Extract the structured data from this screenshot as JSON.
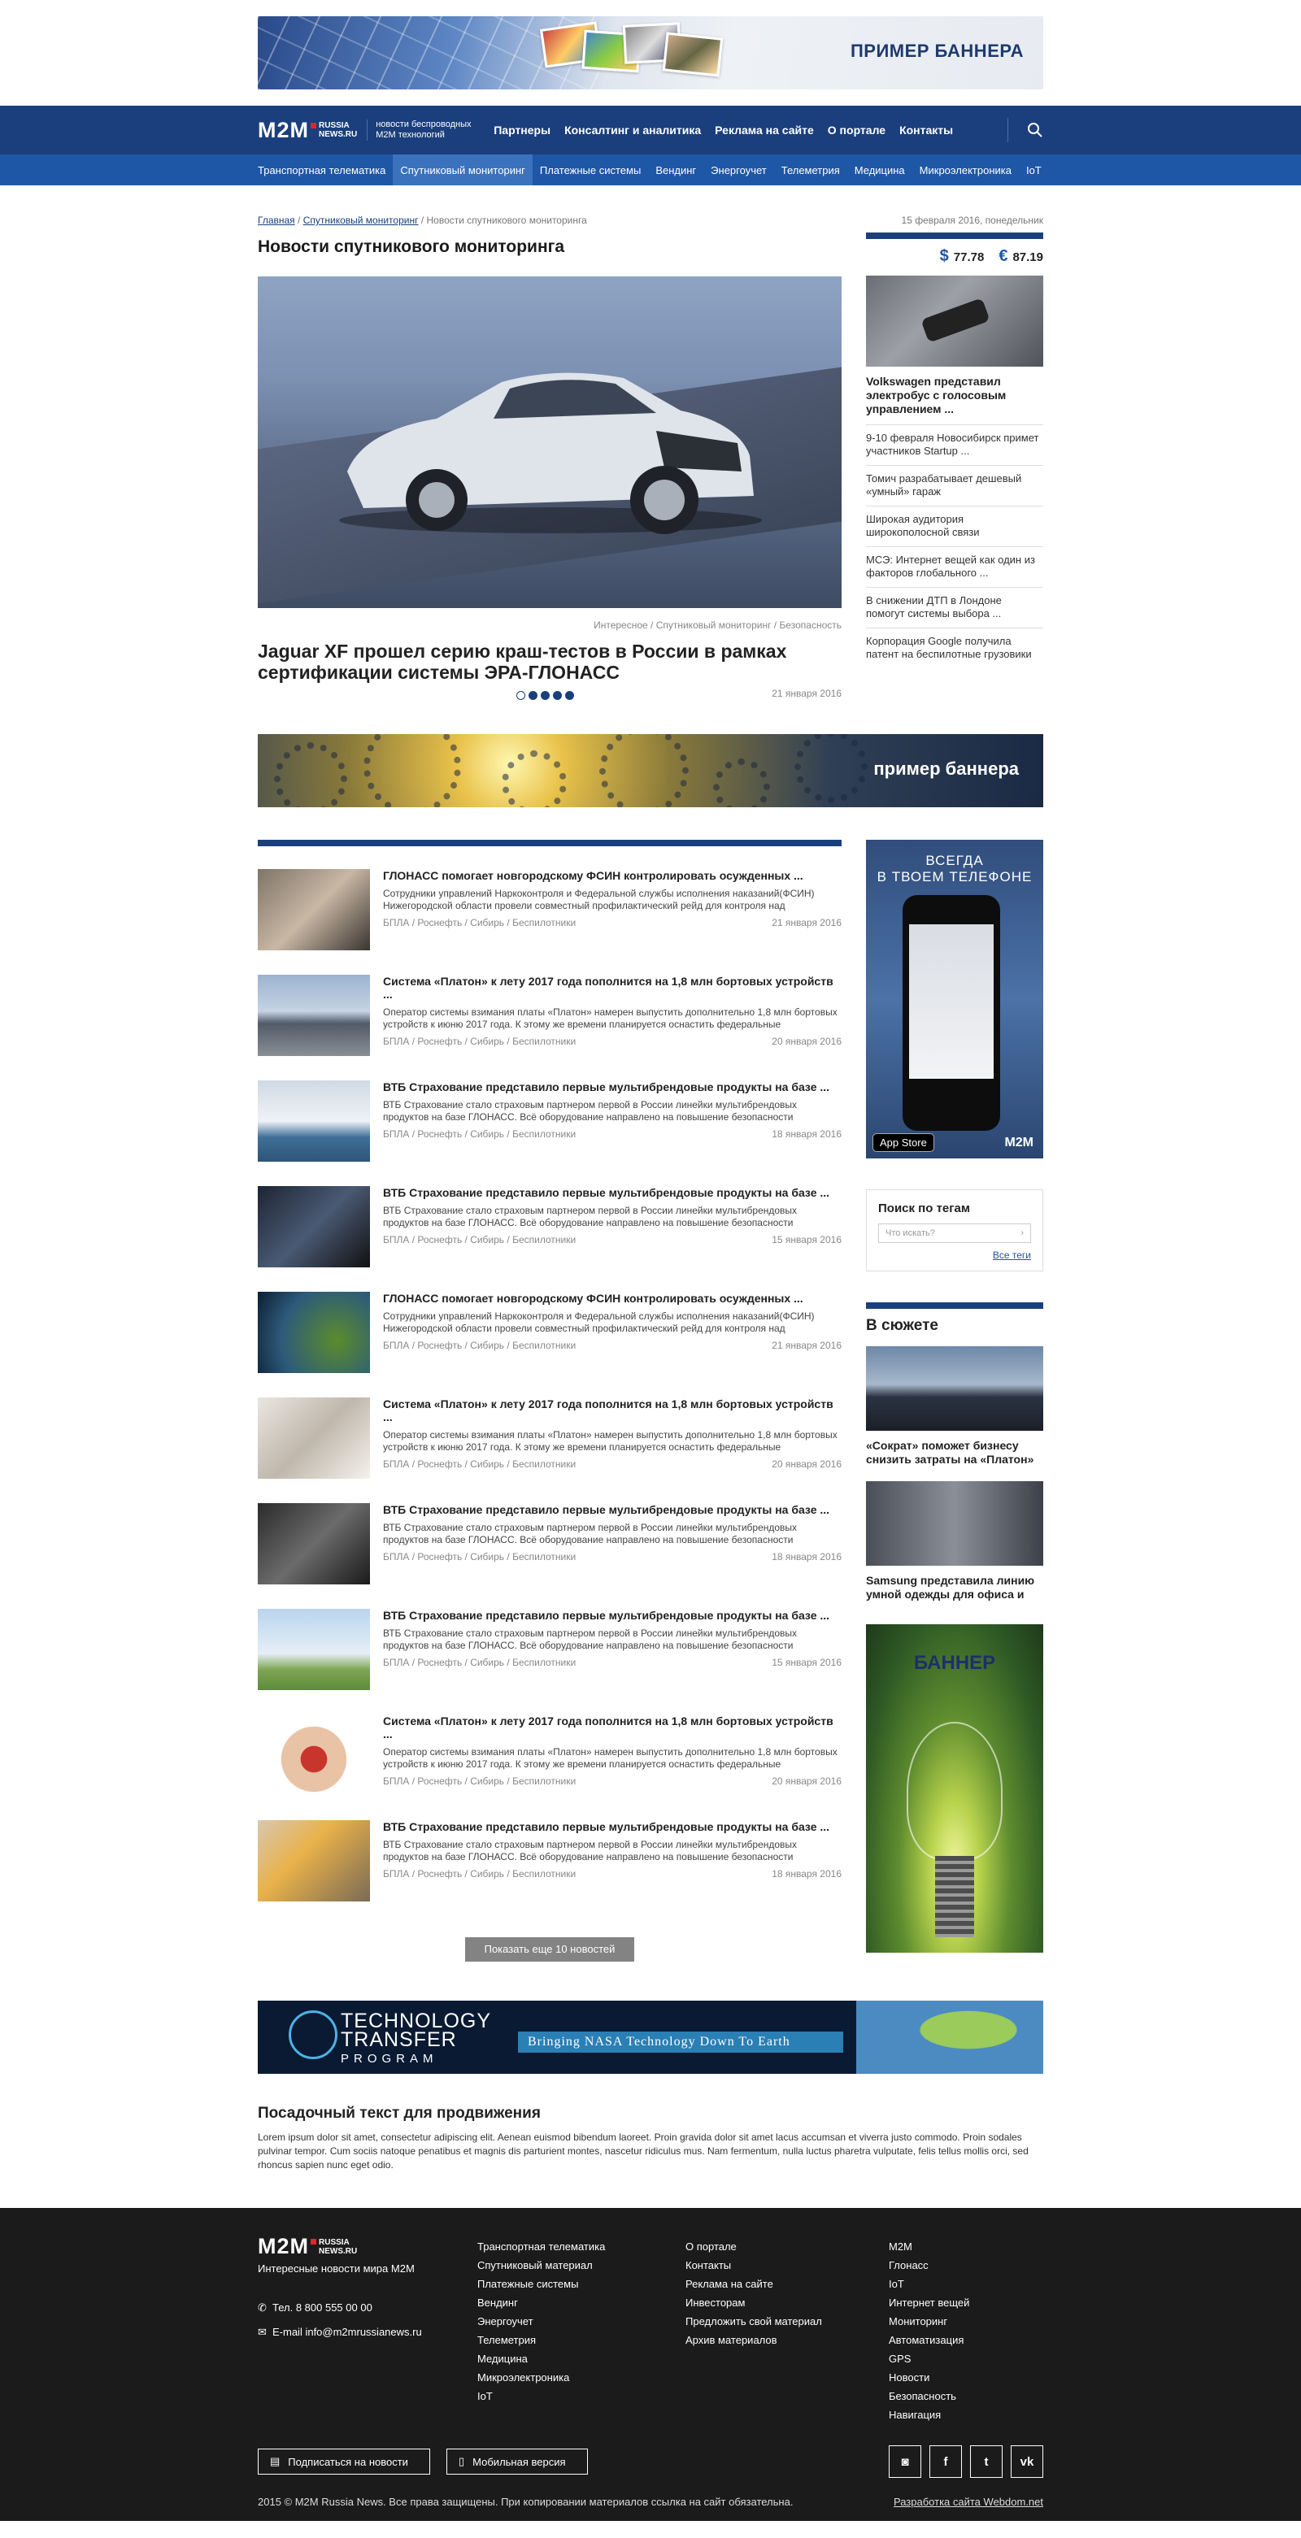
{
  "top_banner": {
    "label": "ПРИМЕР БАННЕРА"
  },
  "header": {
    "logo": "M2M",
    "logo_site_1": "RUSSIA",
    "logo_site_2": "NEWS.RU",
    "tagline": "новости беспроводных M2M технологий",
    "nav": [
      "Партнеры",
      "Консалтинг и аналитика",
      "Реклама на сайте",
      "О портале",
      "Контакты"
    ]
  },
  "subnav": [
    "Транспортная телематика",
    "Спутниковый мониторинг",
    "Платежные системы",
    "Вендинг",
    "Энергоучет",
    "Телеметрия",
    "Медицина",
    "Микроэлектроника",
    "IoT"
  ],
  "breadcrumb": {
    "home": "Главная",
    "section": "Спутниковый мониторинг",
    "current": "Новости спутникового мониторинга"
  },
  "page_title": "Новости спутникового мониторинга",
  "date_top": "15 февраля 2016, понедельник",
  "rates": {
    "usd_sym": "$",
    "usd": "77.78",
    "eur_sym": "€",
    "eur": "87.19"
  },
  "hero": {
    "meta": "Интересное / Спутниковый мониторинг / Безопасность",
    "title": "Jaguar XF прошел серию краш-тестов в России в рамках сертификации системы ЭРА-ГЛОНАСС",
    "date": "21 января 2016"
  },
  "side_news": {
    "lead": "Volkswagen представил электробус с голосовым управлением ...",
    "items": [
      "9-10 февраля Новосибирск примет участников Startup ...",
      "Томич разрабатывает дешевый «умный» гараж",
      "Широкая аудитория широкополосной связи",
      "МСЭ: Интернет вещей как один из факторов глобального ...",
      "В снижении ДТП в Лондоне помогут системы выбора ...",
      "Корпорация Google получила патент на беспилотные грузовики"
    ]
  },
  "mid_banner": {
    "label": "пример баннера"
  },
  "news": [
    {
      "title": "ГЛОНАСС помогает новгородскому ФСИН контролировать осужденных ...",
      "text": "Сотрудники управлений Наркоконтроля и Федеральной службы исполнения наказаний(ФСИН) Нижегородской области провели совместный профилактический рейд для контроля над",
      "tags": "БПЛА / Роснефть / Сибирь / Беспилотники",
      "date": "21 января 2016"
    },
    {
      "title": "Система «Платон» к лету 2017 года пополнится на 1,8 млн бортовых устройств ...",
      "text": "Оператор системы взимания платы «Платон» намерен выпустить дополнительно 1,8 млн бортовых устройств к июню 2017 года. К этому же времени планируется оснастить федеральные",
      "tags": "БПЛА / Роснефть / Сибирь / Беспилотники",
      "date": "20 января 2016"
    },
    {
      "title": "ВТБ Страхование представило первые мультибрендовые продукты на базе ...",
      "text": "ВТБ Страхование стало страховым партнером первой в России линейки мультибрендовых продуктов на базе ГЛОНАСС. Всё оборудование направлено на повышение безопасности",
      "tags": "БПЛА / Роснефть / Сибирь / Беспилотники",
      "date": "18 января 2016"
    },
    {
      "title": "ВТБ Страхование представило первые мультибрендовые продукты на базе ...",
      "text": "ВТБ Страхование стало страховым партнером первой в России линейки мультибрендовых продуктов на базе ГЛОНАСС. Всё оборудование направлено на повышение безопасности",
      "tags": "БПЛА / Роснефть / Сибирь / Беспилотники",
      "date": "15 января 2016"
    },
    {
      "title": "ГЛОНАСС помогает новгородскому ФСИН контролировать осужденных ...",
      "text": "Сотрудники управлений Наркоконтроля и Федеральной службы исполнения наказаний(ФСИН) Нижегородской области провели совместный профилактический рейд для контроля над",
      "tags": "БПЛА / Роснефть / Сибирь / Беспилотники",
      "date": "21 января 2016"
    },
    {
      "title": "Система «Платон» к лету 2017 года пополнится на 1,8 млн бортовых устройств ...",
      "text": "Оператор системы взимания платы «Платон» намерен выпустить дополнительно 1,8 млн бортовых устройств к июню 2017 года. К этому же времени планируется оснастить федеральные",
      "tags": "БПЛА / Роснефть / Сибирь / Беспилотники",
      "date": "20 января 2016"
    },
    {
      "title": "ВТБ Страхование представило первые мультибрендовые продукты на базе ...",
      "text": "ВТБ Страхование стало страховым партнером первой в России линейки мультибрендовых продуктов на базе ГЛОНАСС. Всё оборудование направлено на повышение безопасности",
      "tags": "БПЛА / Роснефть / Сибирь / Беспилотники",
      "date": "18 января 2016"
    },
    {
      "title": "ВТБ Страхование представило первые мультибрендовые продукты на базе ...",
      "text": "ВТБ Страхование стало страховым партнером первой в России линейки мультибрендовых продуктов на базе ГЛОНАСС. Всё оборудование направлено на повышение безопасности",
      "tags": "БПЛА / Роснефть / Сибирь / Беспилотники",
      "date": "15 января 2016"
    },
    {
      "title": "Система «Платон» к лету 2017 года пополнится на 1,8 млн бортовых устройств ...",
      "text": "Оператор системы взимания платы «Платон» намерен выпустить дополнительно 1,8 млн бортовых устройств к июню 2017 года. К этому же времени планируется оснастить федеральные",
      "tags": "БПЛА / Роснефть / Сибирь / Беспилотники",
      "date": "20 января 2016"
    },
    {
      "title": "ВТБ Страхование представило первые мультибрендовые продукты на базе ...",
      "text": "ВТБ Страхование стало страховым партнером первой в России линейки мультибрендовых продуктов на базе ГЛОНАСС. Всё оборудование направлено на повышение безопасности",
      "tags": "БПЛА / Роснефть / Сибирь / Беспилотники",
      "date": "18 января 2016"
    }
  ],
  "more_button": "Показать еще 10 новостей",
  "app_banner": {
    "line1": "ВСЕГДА",
    "line2": "В ТВОЕМ ТЕЛЕФОНЕ",
    "store": "App Store",
    "brand": "M2M"
  },
  "tags_box": {
    "title": "Поиск по тегам",
    "placeholder": "Что искать?",
    "all": "Все теги"
  },
  "story": {
    "title": "В сюжете",
    "items": [
      "«Сократ» поможет бизнесу снизить затраты на «Платон»",
      "Samsung представила линию умной одежды для офиса и"
    ]
  },
  "tall_banner": {
    "label": "БАННЕР"
  },
  "nasa_banner": {
    "line1": "TECHNOLOGY",
    "line2": "TRANSFER",
    "line3": "PROGRAM",
    "slogan": "Bringing NASA Technology Down To Earth"
  },
  "promo": {
    "title": "Посадочный текст для продвижения",
    "text": "Lorem ipsum dolor sit amet, consectetur adipiscing elit. Aenean euismod bibendum laoreet. Proin gravida dolor sit amet lacus accumsan et viverra justo commodo. Proin sodales pulvinar tempor. Cum sociis natoque penatibus et magnis dis parturient montes, nascetur ridiculus mus. Nam fermentum, nulla luctus pharetra vulputate, felis tellus mollis orci, sed rhoncus sapien nunc eget odio."
  },
  "footer": {
    "subtitle": "Интересные новости мира M2M",
    "phone": "Тел. 8 800 555 00 00",
    "email": "E-mail  info@m2mrussianews.ru",
    "col2": [
      "Транспортная телематика",
      "Спутниковый материал",
      "Платежные системы",
      "Вендинг",
      "Энергоучет",
      "Телеметрия",
      "Медицина",
      "Микроэлектроника",
      "IoT"
    ],
    "col3": [
      "О портале",
      "Контакты",
      "Реклама на сайте",
      "Инвесторам",
      "Предложить свой материал",
      "Архив материалов"
    ],
    "col4": [
      "M2M",
      "Глонасс",
      "IoT",
      "Интернет вещей",
      "Мониторинг",
      "Автоматизация",
      "GPS",
      "Новости",
      "Безопасность",
      "Навигация"
    ],
    "subscribe": "Подписаться на новости",
    "mobile": "Мобильная версия",
    "copyright": "2015 © M2M Russia News. Все права защищены. При копировании материалов ссылка на сайт обязательна.",
    "dev": "Разработка сайта Webdom.net"
  }
}
